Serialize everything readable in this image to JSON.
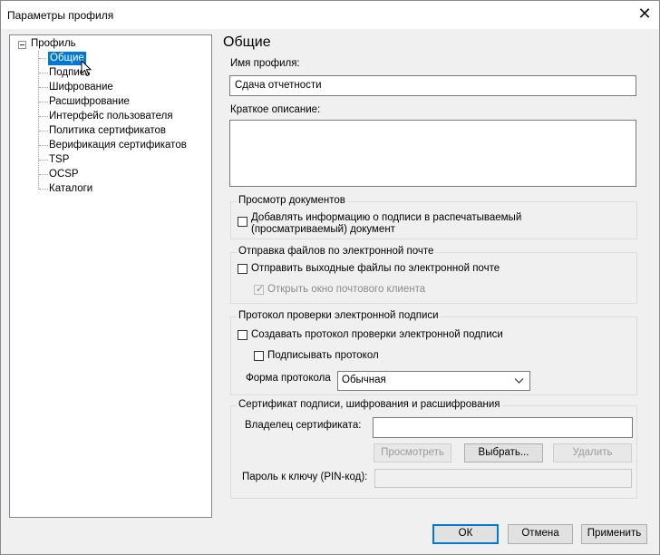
{
  "window": {
    "title": "Параметры профиля"
  },
  "tree": {
    "root": "Профиль",
    "items": [
      "Общие",
      "Подпись",
      "Шифрование",
      "Расшифрование",
      "Интерфейс пользователя",
      "Политика сертификатов",
      "Верификация сертификатов",
      "TSP",
      "OCSP",
      "Каталоги"
    ],
    "selected": "Общие"
  },
  "general": {
    "heading": "Общие",
    "profile_name_label": "Имя профиля:",
    "profile_name_value": "Сдача отчетности",
    "description_label": "Краткое описание:",
    "description_value": ""
  },
  "view_docs": {
    "title": "Просмотр документов",
    "add_sig_info_line1": "Добавлять информацию о подписи в распечатываемый",
    "add_sig_info_line2": "(просматриваемый) документ"
  },
  "email": {
    "title": "Отправка файлов по электронной почте",
    "send_output": "Отправить выходные файлы по электронной почте",
    "open_mail_client": "Открыть окно почтового клиента"
  },
  "protocol": {
    "title": "Протокол проверки электронной подписи",
    "create_protocol": "Создавать протокол проверки электронной подписи",
    "sign_protocol": "Подписывать протокол",
    "form_label": "Форма протокола",
    "form_value": "Обычная"
  },
  "certificate": {
    "title": "Сертификат подписи, шифрования и расшифрования",
    "owner_label": "Владелец сертификата:",
    "view_button": "Просмотреть",
    "select_button": "Выбрать...",
    "delete_button": "Удалить",
    "pin_label": "Пароль к ключу (PIN-код):"
  },
  "footer": {
    "ok": "ОК",
    "cancel": "Отмена",
    "apply": "Применить"
  }
}
